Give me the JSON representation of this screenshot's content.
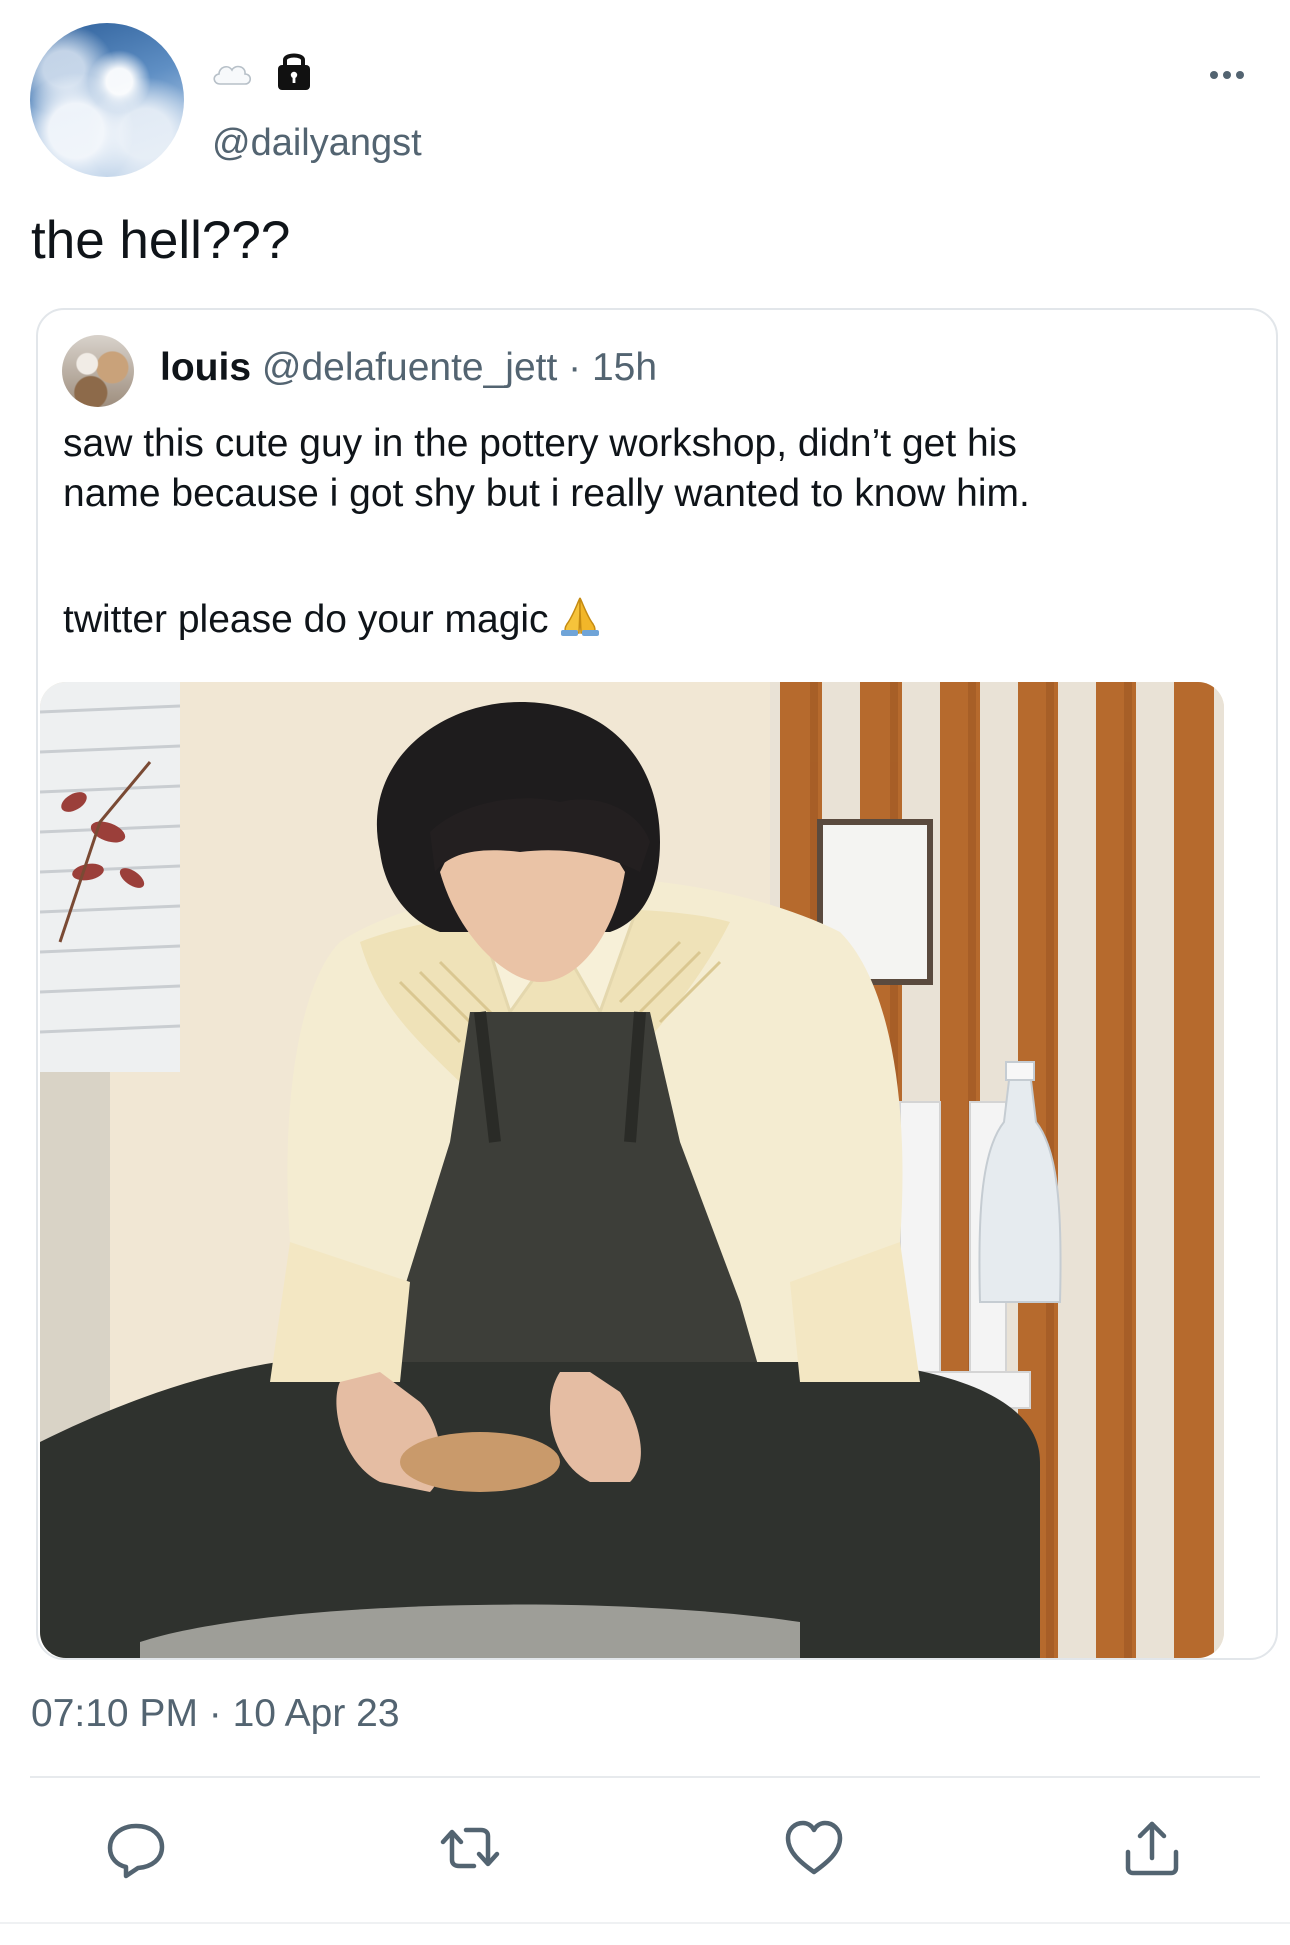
{
  "tweet": {
    "handle": "@dailyangst",
    "text": "the hell???",
    "timestamp": "07:10 PM · 10 Apr 23"
  },
  "quote": {
    "name": "louis",
    "handle_time": "@delafuente_jett · 15h",
    "line1": "saw this cute guy in the pottery workshop, didn’t get his",
    "line2": "name because i got shy but i really wanted to know him.",
    "line3": "twitter please do your magic"
  },
  "icons": {
    "header": [
      "cloud-emoji",
      "lock-icon",
      "more-icon"
    ],
    "actions": [
      "reply-icon",
      "retweet-icon",
      "like-icon",
      "share-icon"
    ]
  },
  "colors": {
    "text": "#0f1419",
    "secondary": "#536471",
    "border": "#e2e6ea"
  }
}
